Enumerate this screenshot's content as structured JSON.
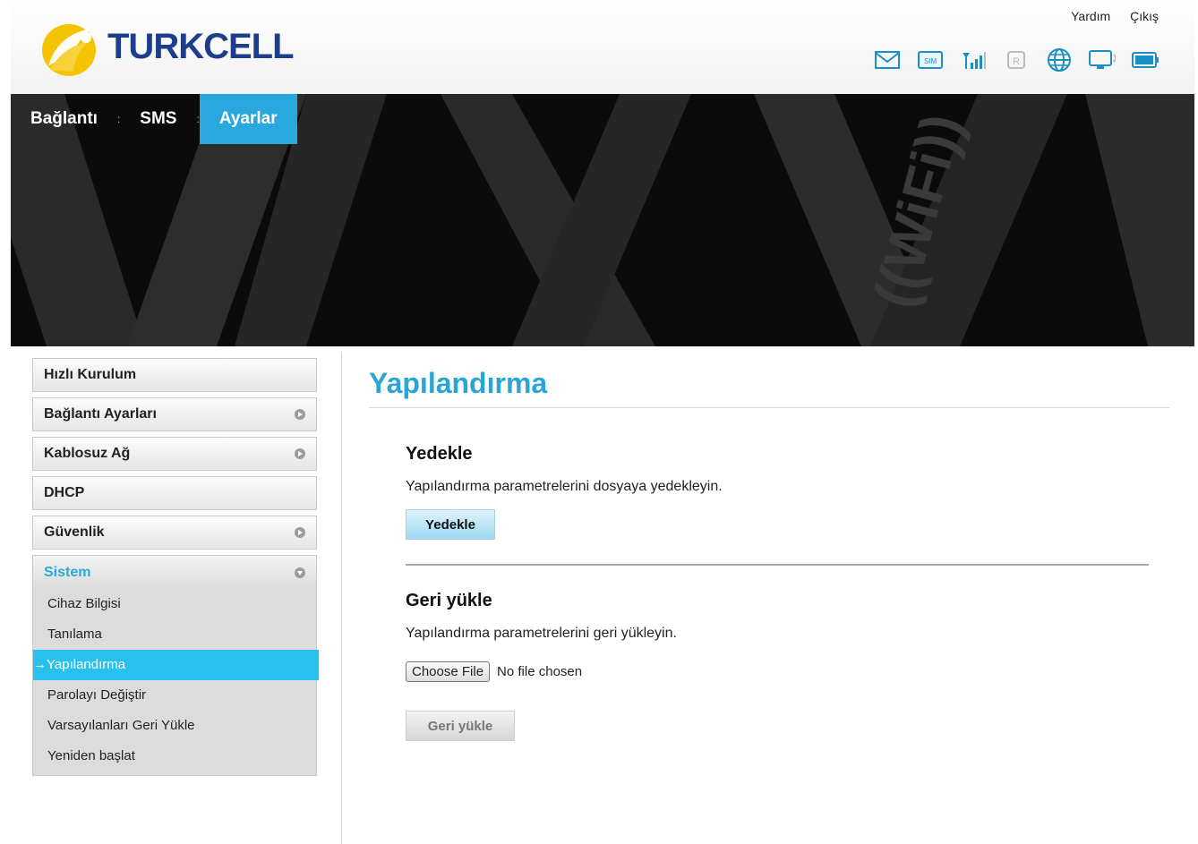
{
  "header": {
    "logo_text": "TURKCELL",
    "links": {
      "help": "Yardım",
      "logout": "Çıkış"
    },
    "status_icons": [
      "mail-icon",
      "sim-icon",
      "signal-icon",
      "roaming-icon",
      "globe-icon",
      "device-icon",
      "battery-icon"
    ]
  },
  "nav": {
    "items": [
      "Bağlantı",
      "SMS",
      "Ayarlar"
    ],
    "separator": ":",
    "active": "Ayarlar"
  },
  "sidebar": {
    "items": [
      {
        "label": "Hızlı Kurulum"
      },
      {
        "label": "Bağlantı Ayarları"
      },
      {
        "label": "Kablosuz Ağ"
      },
      {
        "label": "DHCP"
      },
      {
        "label": "Güvenlik"
      },
      {
        "label": "Sistem"
      }
    ],
    "submenu": [
      {
        "label": "Cihaz Bilgisi"
      },
      {
        "label": "Tanılama"
      },
      {
        "label": "→Yapılandırma"
      },
      {
        "label": "Parolayı Değiştir"
      },
      {
        "label": "Varsayılanları Geri Yükle"
      },
      {
        "label": "Yeniden başlat"
      }
    ]
  },
  "main": {
    "title": "Yapılandırma",
    "backup": {
      "title": "Yedekle",
      "description": "Yapılandırma parametrelerini dosyaya yedekleyin.",
      "button": "Yedekle"
    },
    "restore": {
      "title": "Geri yükle",
      "description": "Yapılandırma parametrelerini geri yükleyin.",
      "file_button": "Choose File",
      "file_status": "No file chosen",
      "button": "Geri yükle"
    }
  },
  "colors": {
    "accent": "#29a8dd",
    "brand_blue": "#1d3e8a",
    "brand_yellow": "#f5c400"
  }
}
